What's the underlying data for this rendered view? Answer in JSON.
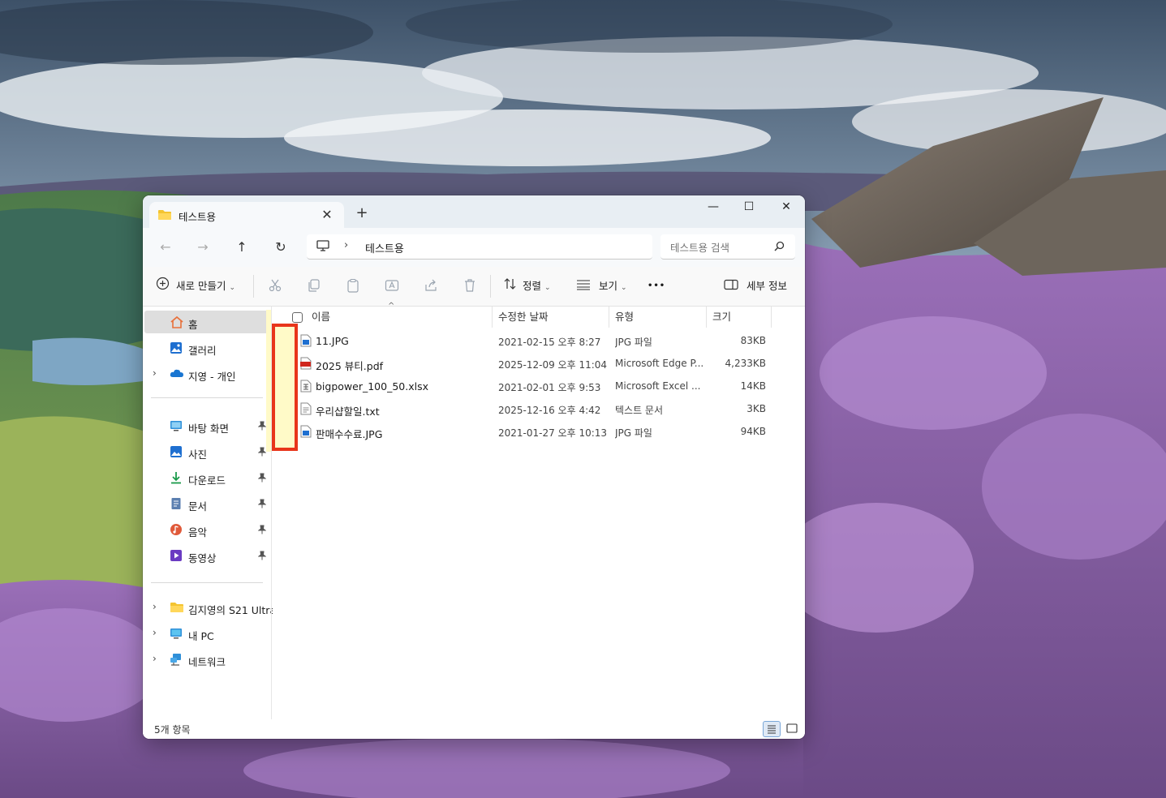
{
  "window": {
    "tab_title": "테스트용",
    "new_tab": "+",
    "tab_close": "✕",
    "minimize": "—",
    "maximize": "☐",
    "close": "✕"
  },
  "nav": {
    "back": "←",
    "forward": "→",
    "up": "↑",
    "refresh": "↻",
    "separator": "›",
    "breadcrumb": "테스트용",
    "search_placeholder": "테스트용 검색"
  },
  "toolbar": {
    "new_label": "새로 만들기",
    "sort_label": "정렬",
    "view_label": "보기",
    "more": "•••",
    "details_label": "세부 정보",
    "caret": "⌄"
  },
  "sidebar": {
    "top_items": [
      {
        "label": "홈",
        "icon": "home-icon"
      },
      {
        "label": "갤러리",
        "icon": "gallery-icon"
      },
      {
        "label": "지영 - 개인",
        "icon": "onedrive-icon"
      }
    ],
    "pinned_items": [
      {
        "label": "바탕 화면",
        "icon": "desktop-icon"
      },
      {
        "label": "사진",
        "icon": "pictures-icon"
      },
      {
        "label": "다운로드",
        "icon": "downloads-icon"
      },
      {
        "label": "문서",
        "icon": "documents-icon"
      },
      {
        "label": "음악",
        "icon": "music-icon"
      },
      {
        "label": "동영상",
        "icon": "videos-icon"
      }
    ],
    "bottom_items": [
      {
        "label": "김지영의 S21 Ultra",
        "icon": "phone-folder-icon"
      },
      {
        "label": "내 PC",
        "icon": "pc-icon"
      },
      {
        "label": "네트워크",
        "icon": "network-icon"
      }
    ],
    "chevron": "›"
  },
  "columns": {
    "name": "이름",
    "date": "수정한 날짜",
    "type": "유형",
    "size": "크기",
    "sort_indicator": "^"
  },
  "files": [
    {
      "name": "11.JPG",
      "date": "2021-02-15 오후 8:27",
      "type": "JPG 파일",
      "size": "83KB",
      "icon": "image-file-icon"
    },
    {
      "name": "2025 뷰티.pdf",
      "date": "2025-12-09 오후 11:04",
      "type": "Microsoft Edge P...",
      "size": "4,233KB",
      "icon": "pdf-file-icon"
    },
    {
      "name": "bigpower_100_50.xlsx",
      "date": "2021-02-01 오후 9:53",
      "type": "Microsoft Excel ...",
      "size": "14KB",
      "icon": "excel-file-icon"
    },
    {
      "name": "우리샵할일.txt",
      "date": "2025-12-16 오후 4:42",
      "type": "텍스트 문서",
      "size": "3KB",
      "icon": "text-file-icon"
    },
    {
      "name": "판매수수료.JPG",
      "date": "2021-01-27 오후 10:13",
      "type": "JPG 파일",
      "size": "94KB",
      "icon": "image-file-icon"
    }
  ],
  "status": {
    "item_count": "5개 항목"
  },
  "colors": {
    "highlight_border": "#e8351b",
    "highlight_fill": "#fffac8",
    "accent": "#0067c0"
  }
}
